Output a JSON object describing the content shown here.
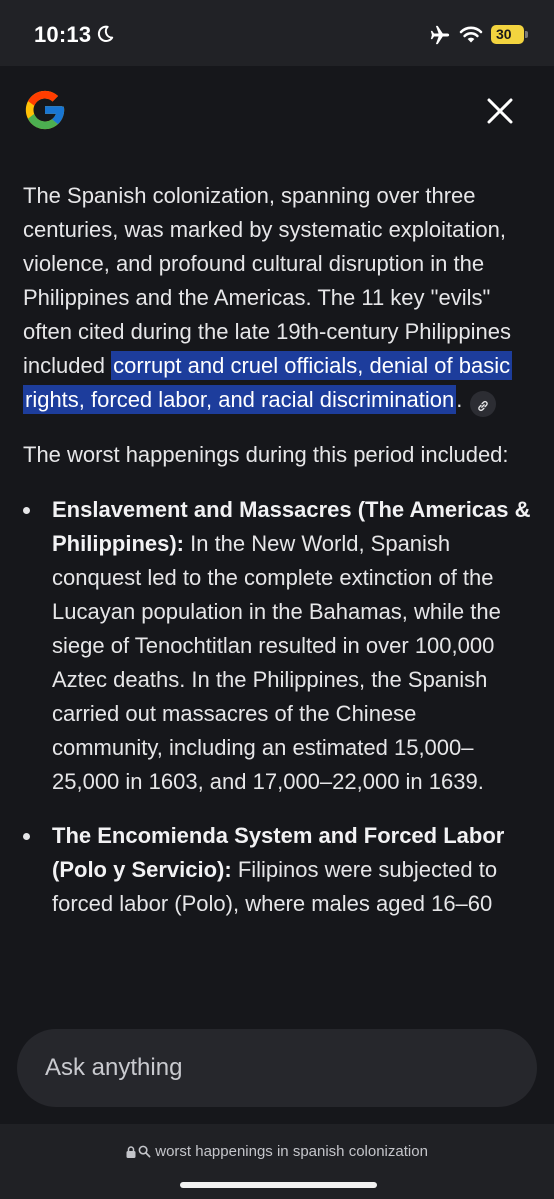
{
  "status": {
    "time": "10:13",
    "battery": "30",
    "icons": [
      "moon-icon",
      "airplane-icon",
      "wifi-icon",
      "battery-icon"
    ]
  },
  "header": {
    "logo": "google-g-icon",
    "close": "close-icon"
  },
  "content": {
    "para1_a": "The Spanish colonization, spanning over three centuries, was marked by systematic exploitation, violence, and profound cultural disruption in the Philippines and the Americas. The 11 key \"evils\" often cited during the late 19th-century Philippines included ",
    "para1_highlight": "corrupt and cruel officials, denial of basic rights, forced labor, and racial discrimination",
    "para1_end": ".",
    "para2": "The worst happenings during this period included:",
    "bullets": [
      {
        "title": "Enslavement and Massacres (The Americas & Philippines):",
        "text": " In the New World, Spanish conquest led to the complete extinction of the Lucayan population in the Bahamas, while the siege of Tenochtitlan resulted in over 100,000 Aztec deaths. In the Philippines, the Spanish carried out massacres of the Chinese community, including an estimated 15,000–25,000 in 1603, and 17,000–22,000 in 1639."
      },
      {
        "title": "The Encomienda System and Forced Labor (Polo y Servicio):",
        "text": " Filipinos were subjected to forced labor (Polo), where males aged 16–60"
      }
    ]
  },
  "ask": {
    "placeholder": "Ask anything"
  },
  "footer": {
    "query": "worst happenings in spanish colonization"
  },
  "colors": {
    "background": "#16171b",
    "highlight": "#1d3d9c",
    "battery": "#f3d43f"
  }
}
